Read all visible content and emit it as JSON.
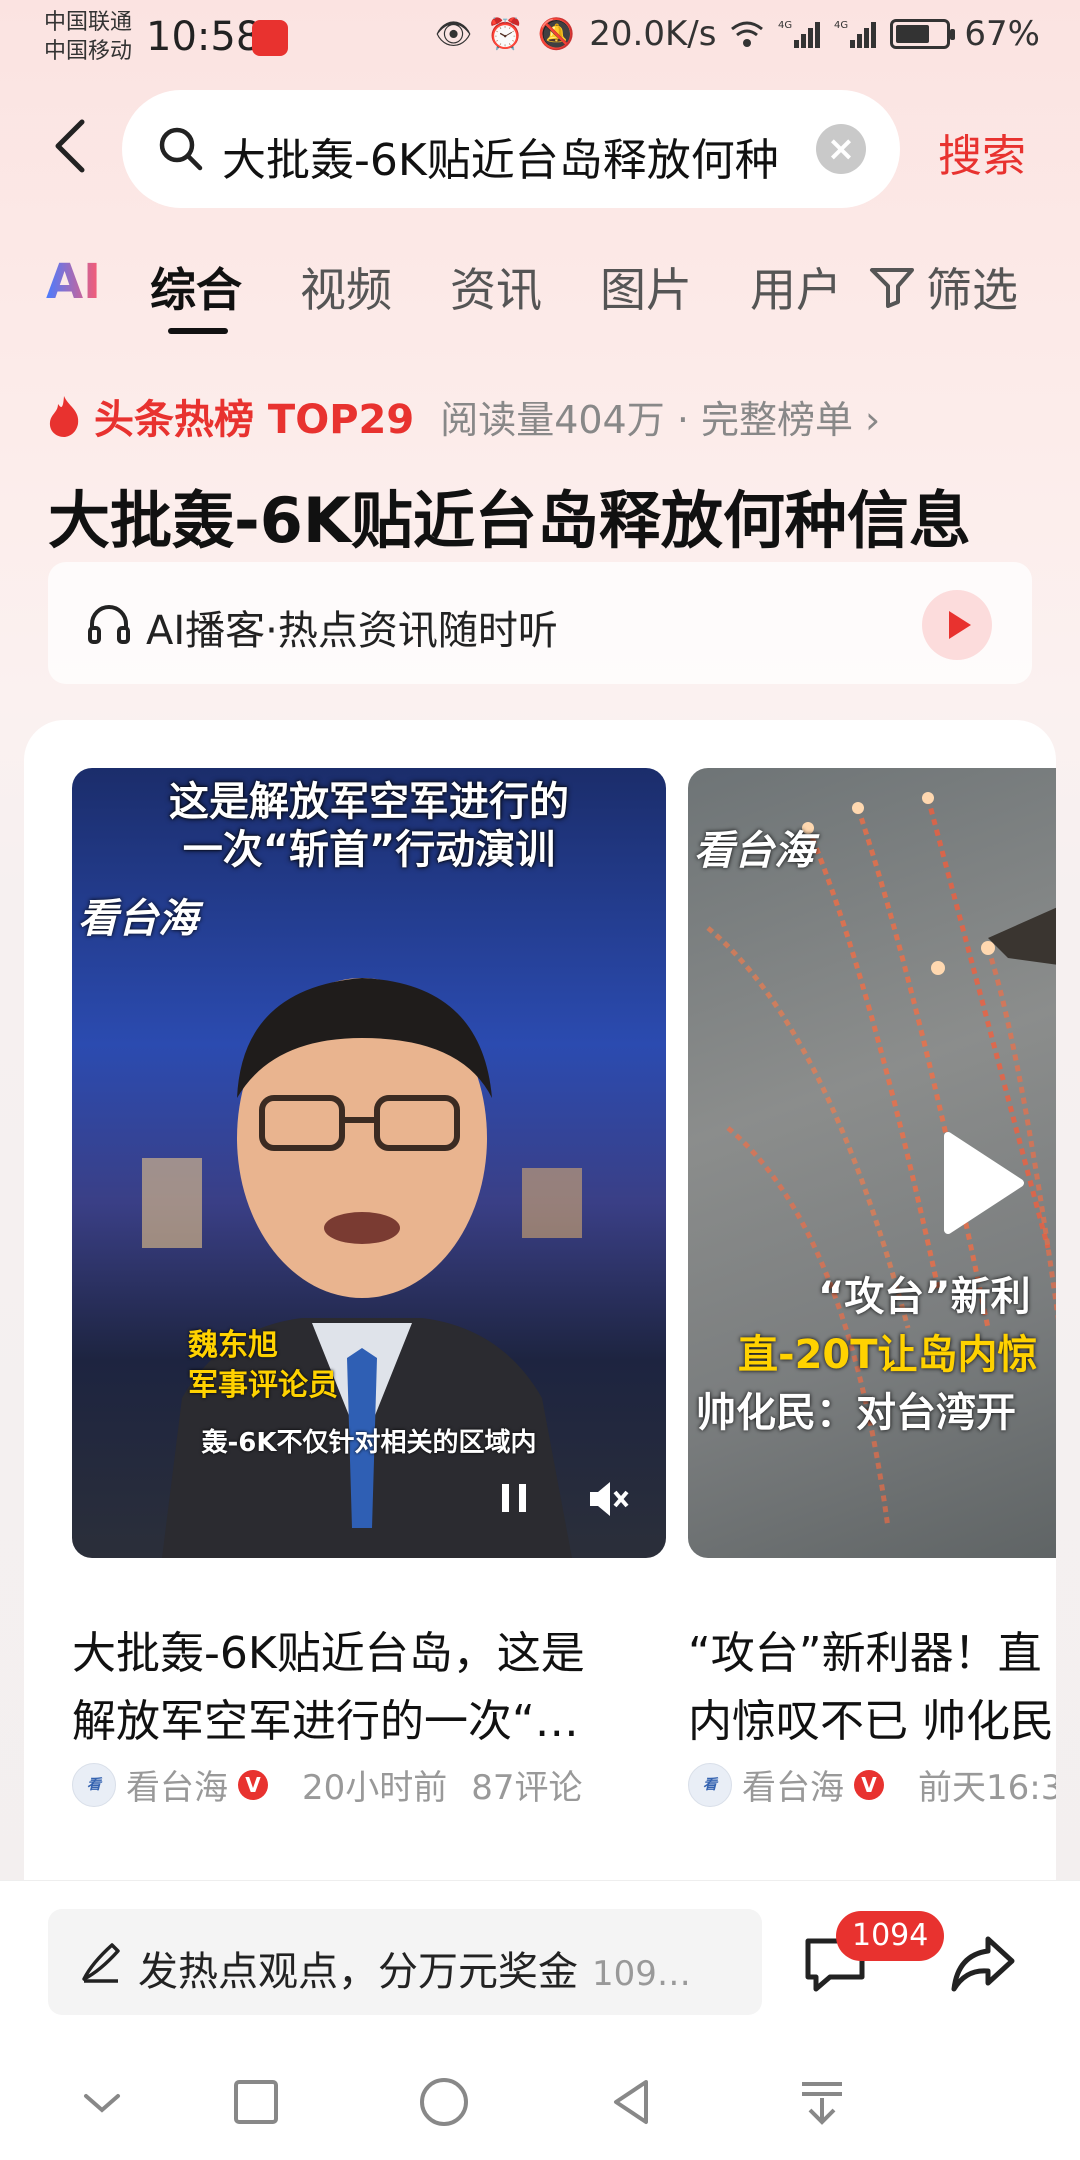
{
  "status_bar": {
    "carrier_1": "中国联通",
    "carrier_2": "中国移动",
    "time": "10:58",
    "speed": "20.0K/s",
    "battery": "67%",
    "battery_level": 0.67,
    "network_1": "4G",
    "network_2": "4G"
  },
  "search": {
    "query": "大批轰-6K贴近台岛释放何种",
    "submit_label": "搜索"
  },
  "tabs": {
    "ai": "AI",
    "items": [
      "综合",
      "视频",
      "资讯",
      "图片",
      "用户"
    ],
    "active": "综合",
    "filter_label": "筛选"
  },
  "hot": {
    "label": "头条热榜 TOP29",
    "meta": "阅读量404万 · 完整榜单 ›",
    "topic_title": "大批轰-6K贴近台岛释放何种信息"
  },
  "podcast": {
    "label": "AI播客·热点资讯随时听"
  },
  "cards": [
    {
      "caption_top_1": "这是解放军空军进行的",
      "caption_top_2": "一次“斩首”行动演训",
      "logo": "看台海",
      "speaker_name": "魏东旭",
      "speaker_role": "军事评论员",
      "subtitle": "轰-6K不仅针对相关的区域内",
      "title_line_1": "大批轰-6K贴近台岛，这是",
      "title_line_2": "解放军空军进行的一次“…",
      "source": "看台海",
      "time": "20小时前",
      "comments": "87评论"
    },
    {
      "logo": "看台海",
      "cap_1": "“攻台”新利",
      "cap_2": "直-20T让岛内惊",
      "cap_3": "帅化民：对台湾开",
      "title_line_1": "“攻台”新利器！直",
      "title_line_2": "内惊叹不已 帅化民",
      "source": "看台海",
      "time": "前天16:3"
    }
  ],
  "bottom_bar": {
    "comment_prompt": "发热点观点，分万元奖金",
    "comment_count_text": "109…",
    "comment_badge": "1094"
  },
  "colors": {
    "accent": "#e8322f",
    "badge_yellow": "#ffd200"
  }
}
